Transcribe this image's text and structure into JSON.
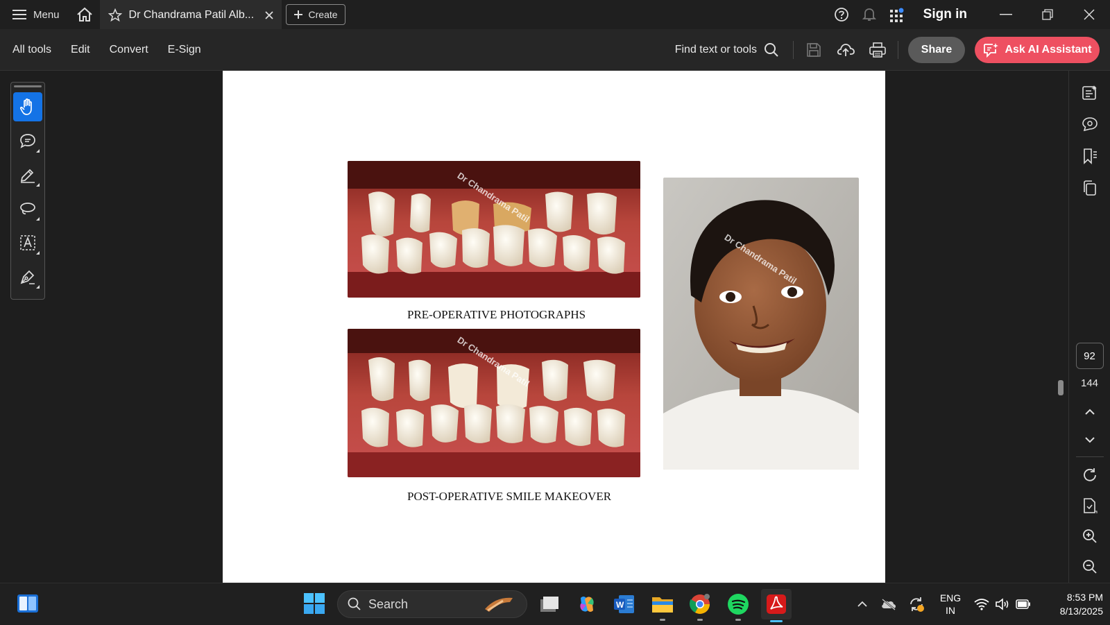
{
  "titlebar": {
    "menu_label": "Menu",
    "tab_title": "Dr Chandrama Patil Alb...",
    "create_label": "Create",
    "signin_label": "Sign in"
  },
  "toolbar": {
    "items": [
      "All tools",
      "Edit",
      "Convert",
      "E-Sign"
    ],
    "find_label": "Find text or tools",
    "share_label": "Share",
    "ai_label": "Ask AI Assistant"
  },
  "document": {
    "watermark": "Dr Chandrama Patil",
    "caption_pre": "PRE-OPERATIVE PHOTOGRAPHS",
    "caption_post": "POST-OPERATIVE SMILE MAKEOVER"
  },
  "navigation": {
    "current_page": "92",
    "total_pages": "144"
  },
  "taskbar": {
    "search_placeholder": "Search",
    "lang_line1": "ENG",
    "lang_line2": "IN",
    "time": "8:53 PM",
    "date": "8/13/2025"
  },
  "colors": {
    "accent_blue": "#1473e6",
    "ai_button": "#ee5061",
    "share_button": "#5a5a5a"
  }
}
